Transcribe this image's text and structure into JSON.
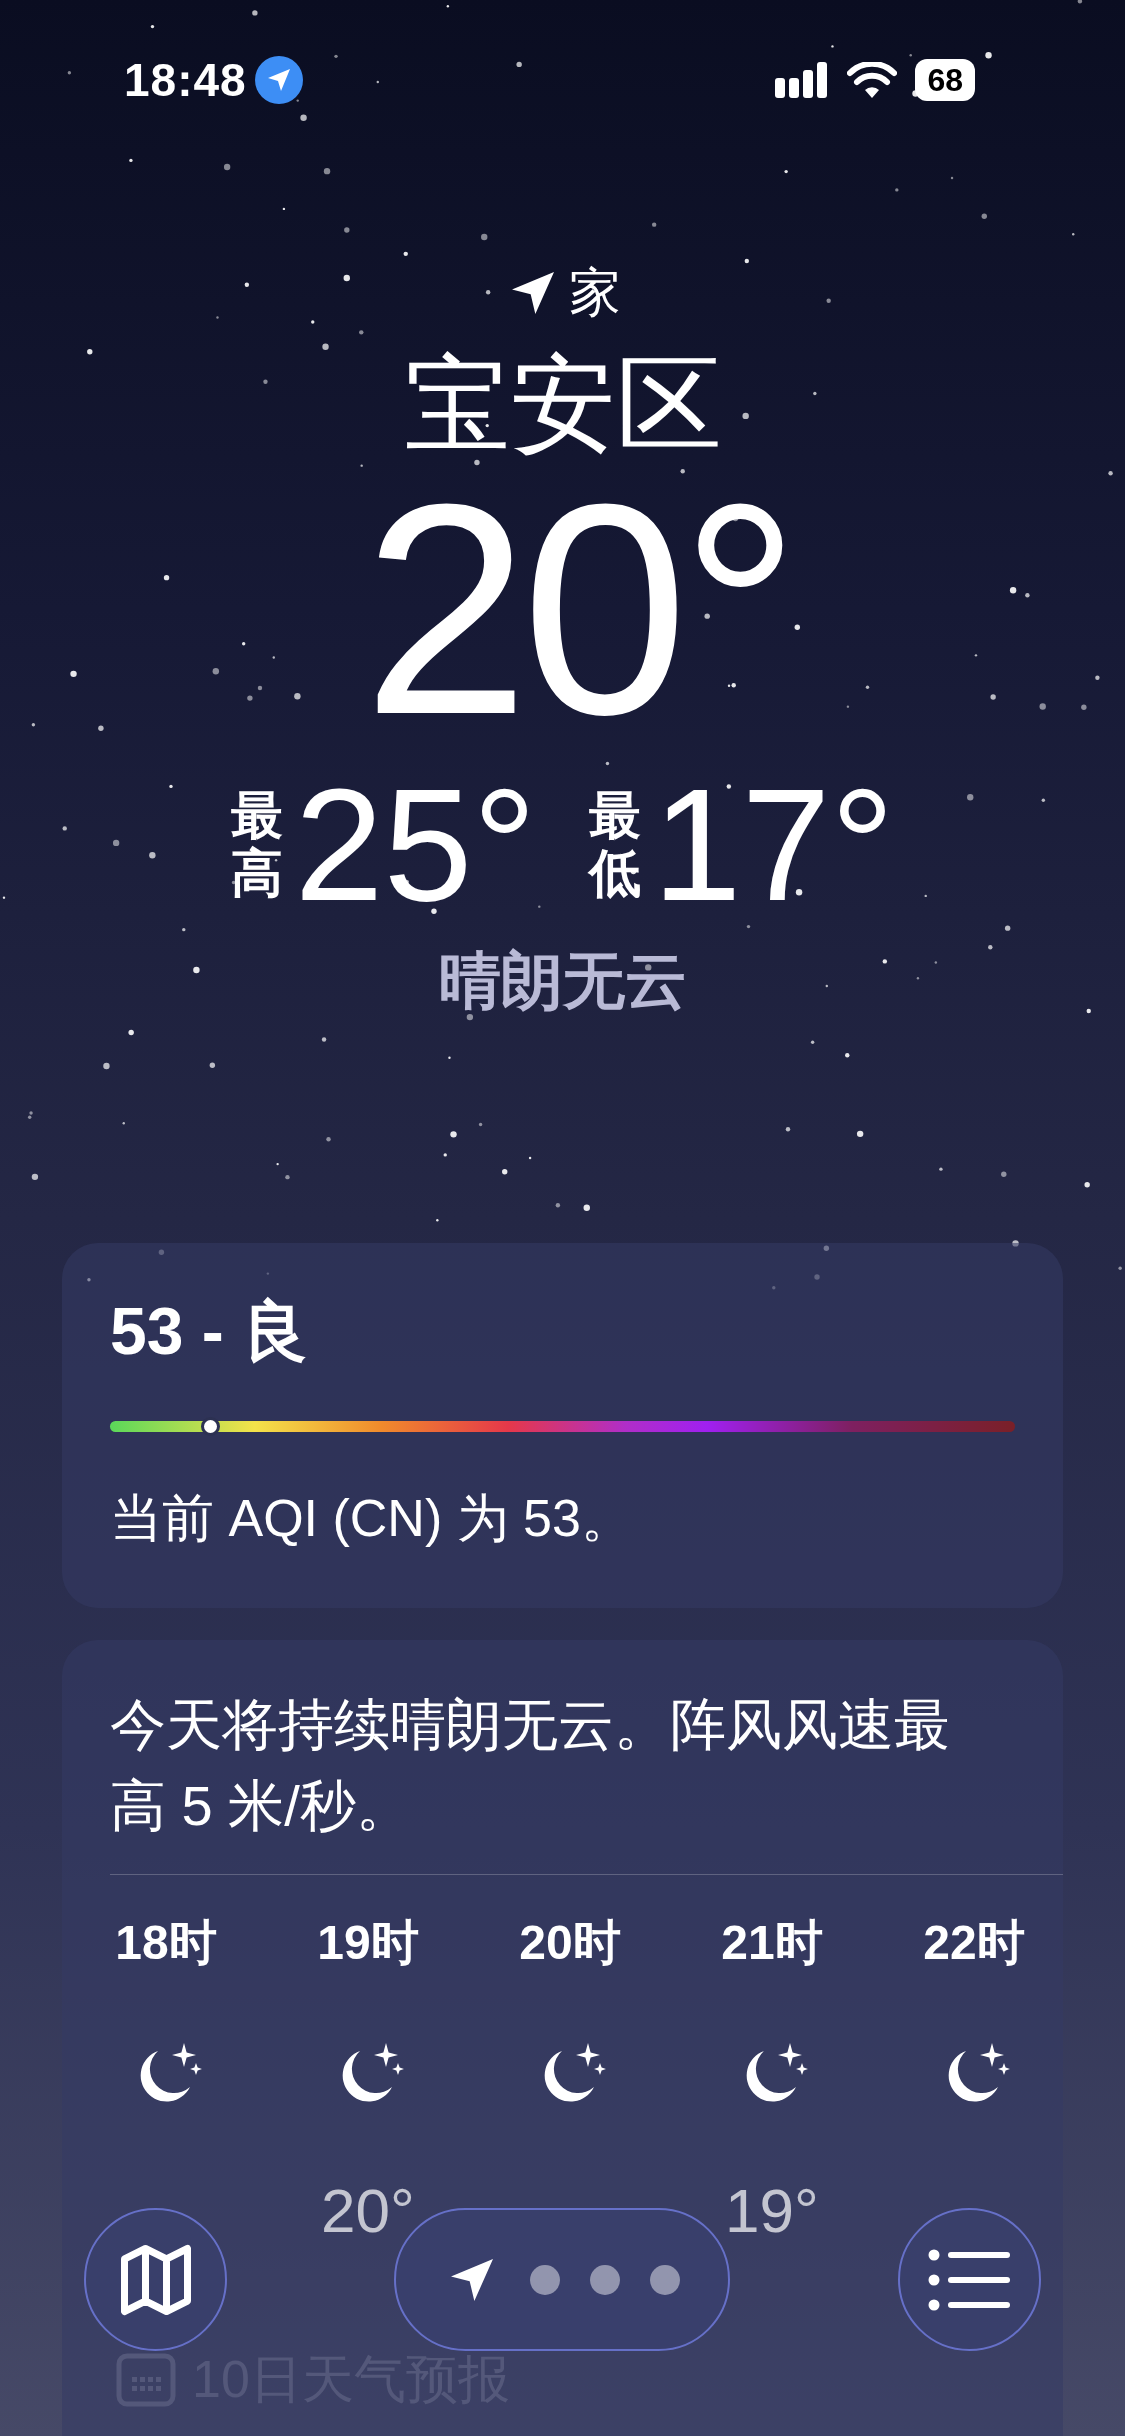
{
  "status_bar": {
    "time": "18:48",
    "battery": "68"
  },
  "location": {
    "label": "家",
    "city": "宝安区",
    "temperature": "20°",
    "high_label": "最高",
    "high": "25°",
    "low_label": "最低",
    "low": "17°",
    "condition": "晴朗无云"
  },
  "aqi": {
    "title": "53 - 良",
    "level": 0.11,
    "description": "当前 AQI (CN) 为 53。"
  },
  "forecast": {
    "summary": "今天将持续晴朗无云。阵风风速最高 5 米/秒。",
    "hours": [
      {
        "time": "18时",
        "kind": "night"
      },
      {
        "time": "19时",
        "kind": "night",
        "temp": "20°"
      },
      {
        "time": "20时",
        "kind": "night"
      },
      {
        "time": "21时",
        "kind": "night",
        "temp": "19°"
      },
      {
        "time": "22时",
        "kind": "night"
      }
    ]
  },
  "ten_day_label": "10日天气预报",
  "pages": [
    {
      "kind": "location",
      "selected": true
    },
    {
      "kind": "dot",
      "selected": false
    },
    {
      "kind": "dot",
      "selected": false
    },
    {
      "kind": "dot",
      "selected": false
    }
  ]
}
